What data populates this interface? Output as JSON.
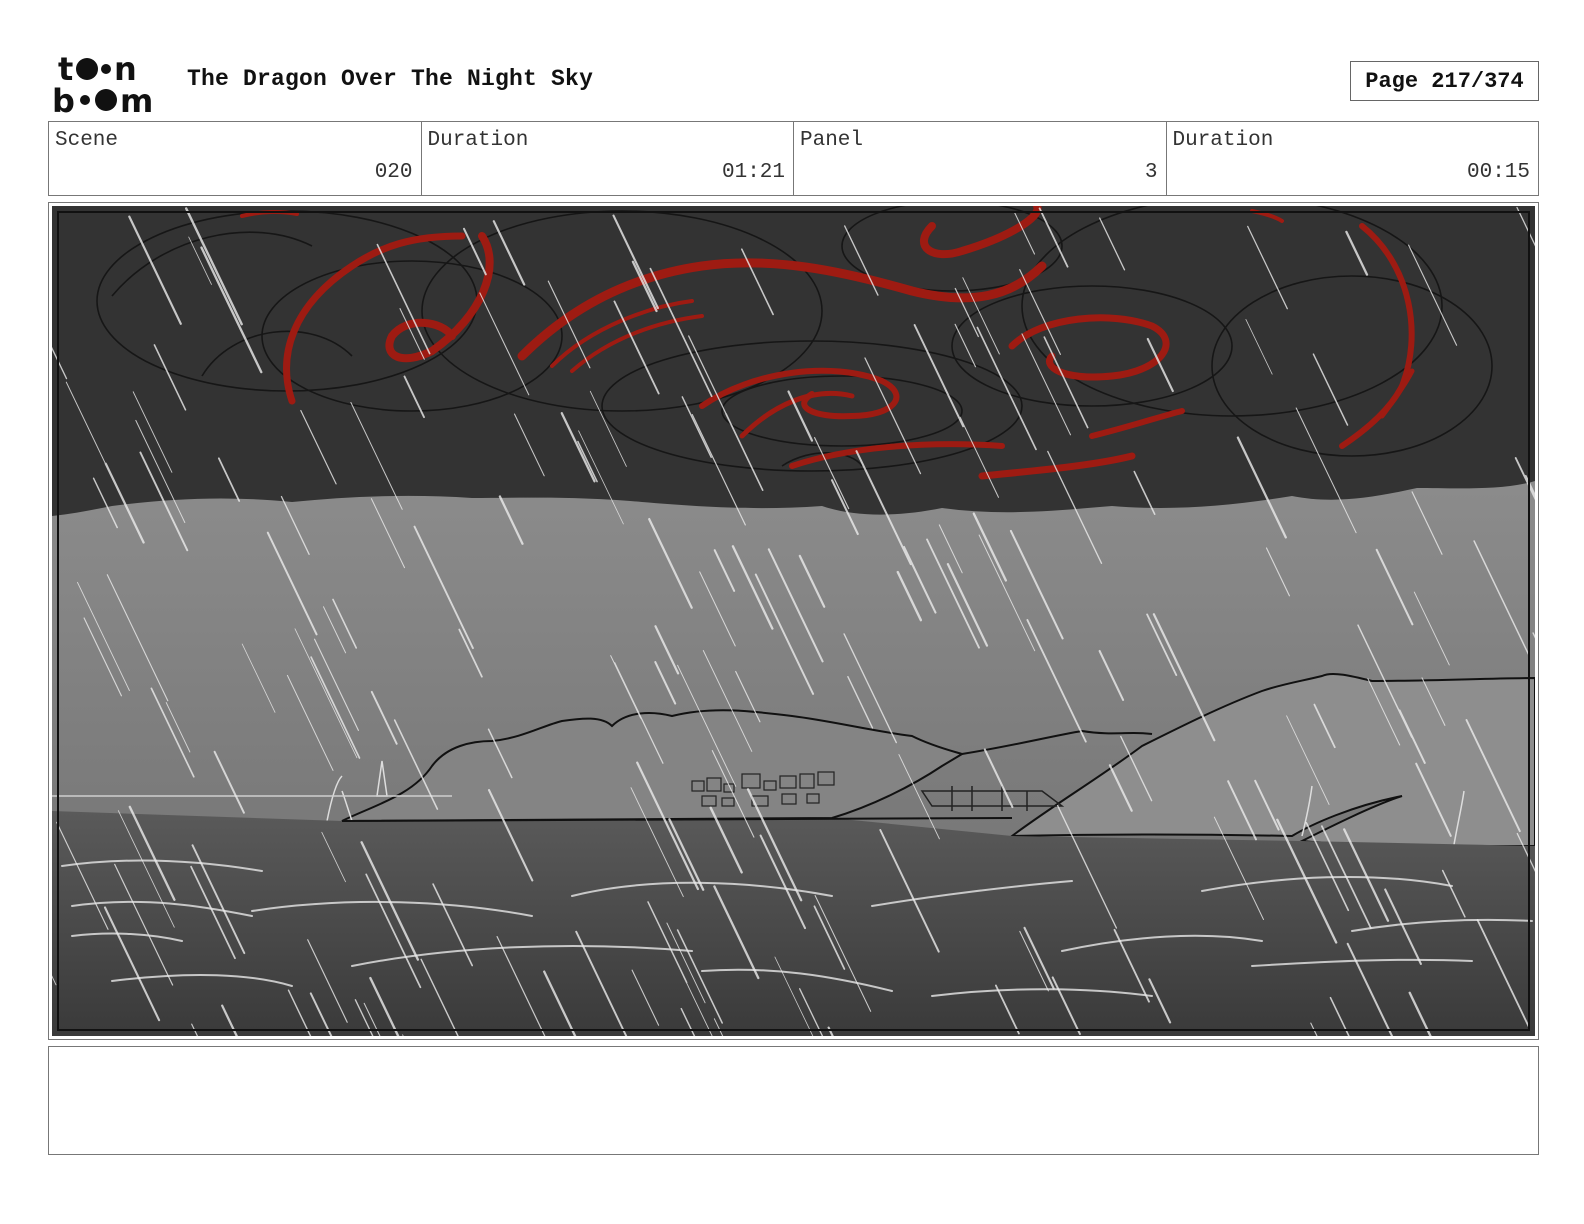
{
  "header": {
    "logo_text": "toon boom",
    "title": "The Dragon Over The Night Sky",
    "page_indicator": "Page 217/374"
  },
  "meta": [
    {
      "label": "Scene",
      "value": "020"
    },
    {
      "label": "Duration",
      "value": "01:21"
    },
    {
      "label": "Panel",
      "value": "3"
    },
    {
      "label": "Duration",
      "value": "00:15"
    }
  ],
  "panel": {
    "description": "",
    "colors": {
      "sky": "#333333",
      "swirl_accent": "#9e1b12",
      "haze": "#8a8a8a",
      "sea": "#4a4a4a",
      "rain": "#e8e8e8"
    }
  },
  "notes": {
    "text": ""
  }
}
